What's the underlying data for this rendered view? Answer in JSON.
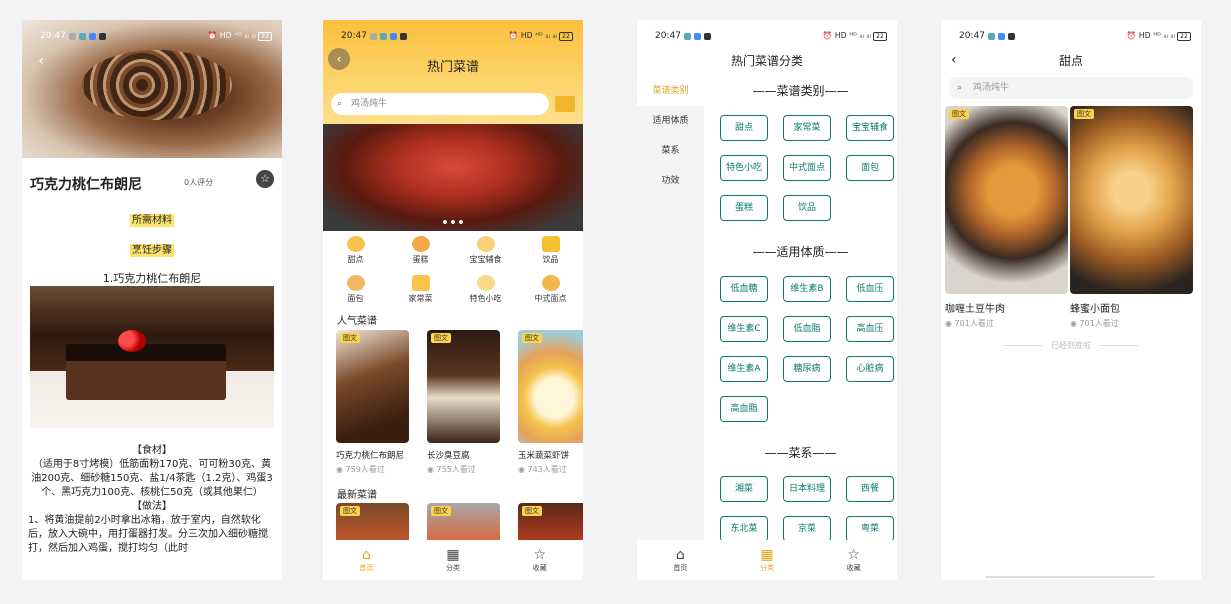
{
  "status_bar": {
    "time": "20:47",
    "indicators": "⏰ HD ᴴᴰ ᵢₗₗ ᵢₗₗ",
    "battery": "22"
  },
  "colors": {
    "accent": "#fcc845",
    "teal": "#0b7a6b",
    "tag": "#fcd34d"
  },
  "screen1": {
    "title": "巧克力桃仁布朗尼",
    "rating": "0人评分",
    "materials_label": "所需材料",
    "steps_label": "烹饪步骤",
    "step1_title": "1.巧克力桃仁布朗尼",
    "ingredients_heading": "【食材】",
    "ingredients_text": "（适用于8寸烤模）低筋面粉170克、可可粉30克、黄油200克、细砂糖150克、盐1/4茶匙（1.2克）、鸡蛋3个、黑巧克力100克、核桃仁50克（或其他果仁）",
    "method_heading": "【做法】",
    "method_text": "1、将黄油提前2小时拿出冰箱，放于室内，自然软化后，放入大碗中，用打蛋器打发。分三次加入细砂糖搅打，然后加入鸡蛋，搅打均匀（此时"
  },
  "screen2": {
    "title": "热门菜谱",
    "search_placeholder": "鸡汤炖牛",
    "categories": [
      "甜点",
      "蛋糕",
      "宝宝辅食",
      "饮品",
      "面包",
      "家常菜",
      "特色小吃",
      "中式面点"
    ],
    "popular_label": "人气菜谱",
    "popular": [
      {
        "tag": "图文",
        "name": "巧克力桃仁布朗尼",
        "views": "759人看过"
      },
      {
        "tag": "图文",
        "name": "长沙臭豆腐",
        "views": "755人看过"
      },
      {
        "tag": "图文",
        "name": "玉米蔬菜虾饼",
        "views": "743人看过"
      }
    ],
    "newest_label": "最新菜谱",
    "newest_tags": [
      "图文",
      "图文",
      "图文"
    ],
    "tabs": [
      "首页",
      "分类",
      "收藏"
    ]
  },
  "screen3": {
    "title": "热门菜谱分类",
    "side": [
      "菜谱类别",
      "适用体质",
      "菜系",
      "功效"
    ],
    "group1_title": "菜谱类别",
    "group1": [
      "甜点",
      "家常菜",
      "宝宝辅食",
      "特色小吃",
      "中式面点",
      "面包",
      "蛋糕",
      "饮品"
    ],
    "group2_title": "适用体质",
    "group2": [
      "低血糖",
      "维生素B",
      "低血压",
      "维生素C",
      "低血脂",
      "高血压",
      "维生素A",
      "糖尿病",
      "心脏病",
      "高血脂"
    ],
    "group3_title": "菜系",
    "group3": [
      "湘菜",
      "日本料理",
      "西餐",
      "东北菜",
      "京菜",
      "粤菜"
    ],
    "tabs": [
      "首页",
      "分类",
      "收藏"
    ]
  },
  "screen4": {
    "title": "甜点",
    "search_placeholder": "鸡汤炖牛",
    "items": [
      {
        "tag": "图文",
        "name": "咖喱土豆牛肉",
        "views": "701人看过"
      },
      {
        "tag": "图文",
        "name": "蜂蜜小面包",
        "views": "701人看过"
      }
    ],
    "end_note": "已经到底啦"
  }
}
